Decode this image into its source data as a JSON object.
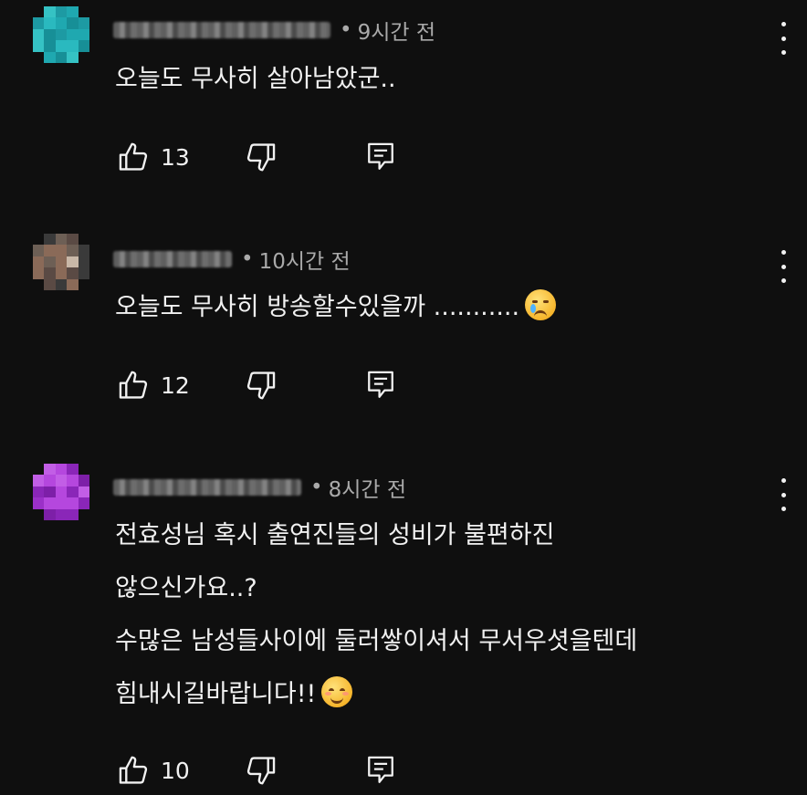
{
  "comments": [
    {
      "time": "9시간 전",
      "text_lines": [
        "오늘도 무사히 살아남았군.."
      ],
      "likes": "13",
      "avatar_colors": [
        "#1fa8b0",
        "#2ab9bf",
        "#1d9aa3",
        "#35c2c4",
        "#178f97"
      ]
    },
    {
      "time": "10시간 전",
      "text_lines": [
        "오늘도 무사히 방송할수있을까 ..........."
      ],
      "likes": "12",
      "avatar_colors": [
        "#8a6a58",
        "#5a4a44",
        "#c9b8a8",
        "#3a3a3a",
        "#6d5f55"
      ],
      "emoji": "crying-face"
    },
    {
      "time": "8시간 전",
      "text_lines": [
        "전효성님 혹시 출연진들의 성비가 불편하진",
        "않으신가요..?",
        "수많은 남성들사이에 둘러쌓이셔서 무서우셧을텐데",
        "힘내시길바랍니다!!"
      ],
      "likes": "10",
      "avatar_colors": [
        "#9b30c8",
        "#b547de",
        "#8a26b8",
        "#c25ee6",
        "#7d1fa8"
      ],
      "emoji": "smiling-face"
    }
  ],
  "icons": {
    "like": "thumbs-up-icon",
    "dislike": "thumbs-down-icon",
    "reply": "reply-icon",
    "menu": "more-vert-icon"
  }
}
